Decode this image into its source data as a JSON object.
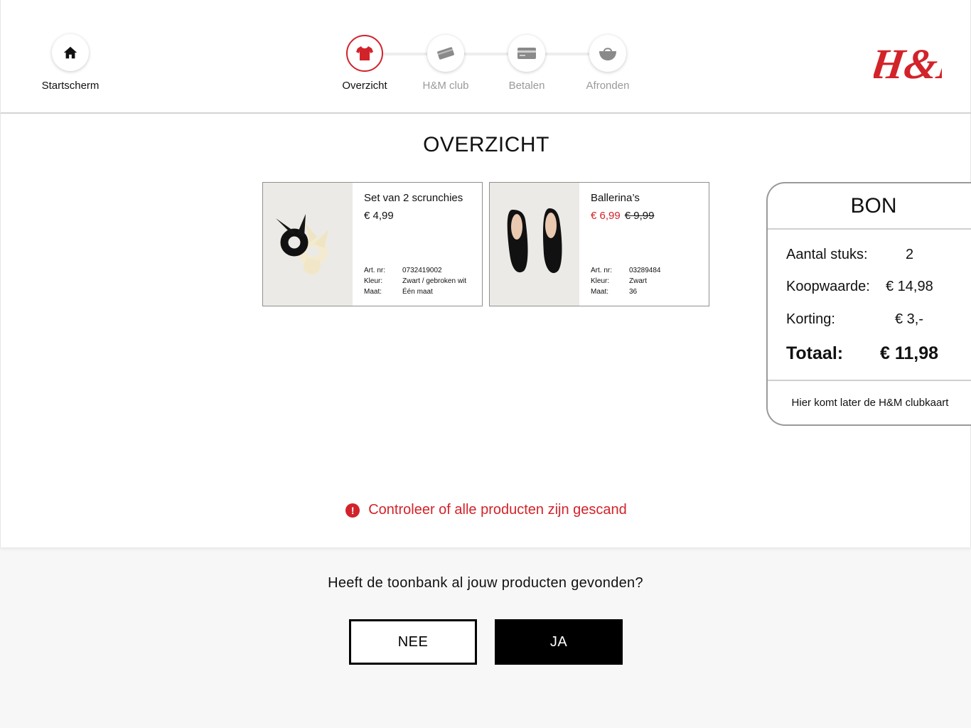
{
  "nav": {
    "home_label": "Startscherm",
    "steps": [
      {
        "label": "Overzicht",
        "state": "active",
        "icon": "tshirt-icon"
      },
      {
        "label": "H&M club",
        "state": "upcoming",
        "icon": "card-icon"
      },
      {
        "label": "Betalen",
        "state": "upcoming",
        "icon": "credit-card-icon"
      },
      {
        "label": "Afronden",
        "state": "upcoming",
        "icon": "basket-icon"
      }
    ]
  },
  "brand": {
    "logo_text": "H&M",
    "accent": "#d2232a"
  },
  "page": {
    "title": "OVERZICHT"
  },
  "products": [
    {
      "name": "Set van 2 scrunchies",
      "price": "€ 4,99",
      "meta": [
        {
          "key": "Art. nr:",
          "value": "0732419002"
        },
        {
          "key": "Kleur:",
          "value": "Zwart / gebroken wit"
        },
        {
          "key": "Maat:",
          "value": "Één maat"
        }
      ]
    },
    {
      "name": "Ballerina’s",
      "sale_price": "€ 6,99",
      "old_price": "€ 9,99",
      "meta": [
        {
          "key": "Art. nr:",
          "value": "03289484"
        },
        {
          "key": "Kleur:",
          "value": "Zwart"
        },
        {
          "key": "Maat:",
          "value": "36"
        }
      ]
    }
  ],
  "receipt": {
    "title": "BON",
    "rows": [
      {
        "label": "Aantal stuks:",
        "value": "2"
      },
      {
        "label": "Koopwaarde:",
        "value": "€ 14,98"
      },
      {
        "label": "Korting:",
        "value": "€ 3,-"
      },
      {
        "label": "Totaal:",
        "value": "€ 11,98"
      }
    ],
    "club_note": "Hier komt later de H&M clubkaart"
  },
  "warning": {
    "text": "Controleer of alle producten zijn gescand",
    "icon": "exclamation-icon"
  },
  "prompt": {
    "question": "Heeft de toonbank al jouw producten gevonden?",
    "no_label": "NEE",
    "yes_label": "JA"
  }
}
